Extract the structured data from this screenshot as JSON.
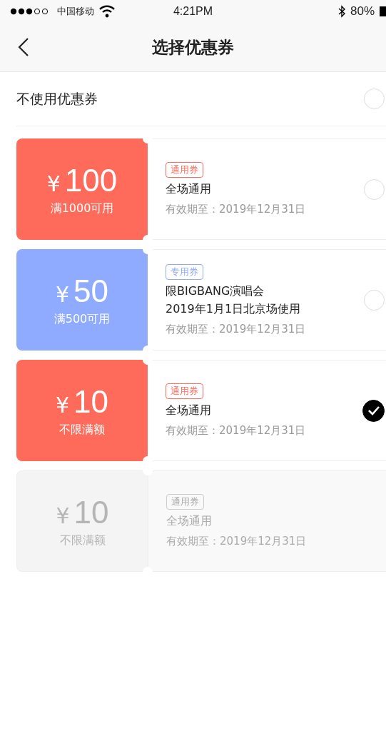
{
  "status_bar": {
    "carrier": "中国移动",
    "time": "4:21PM",
    "battery": "80%"
  },
  "nav": {
    "title": "选择优惠券"
  },
  "no_coupon": {
    "label": "不使用优惠券",
    "selected": false
  },
  "coupons": [
    {
      "currency": "¥",
      "amount": "100",
      "condition": "满1000可用",
      "tag": "通用券",
      "color": "#ff6b5b",
      "lines": [
        "全场通用"
      ],
      "validity": "有效期至：2019年12月31日",
      "selected": false,
      "disabled": false
    },
    {
      "currency": "¥",
      "amount": "50",
      "condition": "满500可用",
      "tag": "专用券",
      "color": "#8fabff",
      "lines": [
        "限BIGBANG演唱会",
        "2019年1月1日北京场使用"
      ],
      "validity": "有效期至：2019年12月31日",
      "selected": false,
      "disabled": false
    },
    {
      "currency": "¥",
      "amount": "10",
      "condition": "不限满额",
      "tag": "通用券",
      "color": "#ff6b5b",
      "lines": [
        "全场通用"
      ],
      "validity": "有效期至：2019年12月31日",
      "selected": true,
      "disabled": false
    },
    {
      "currency": "¥",
      "amount": "10",
      "condition": "不限满额",
      "tag": "通用券",
      "lines": [
        "全场通用"
      ],
      "validity": "有效期至：2019年12月31日",
      "selected": false,
      "disabled": true
    }
  ]
}
